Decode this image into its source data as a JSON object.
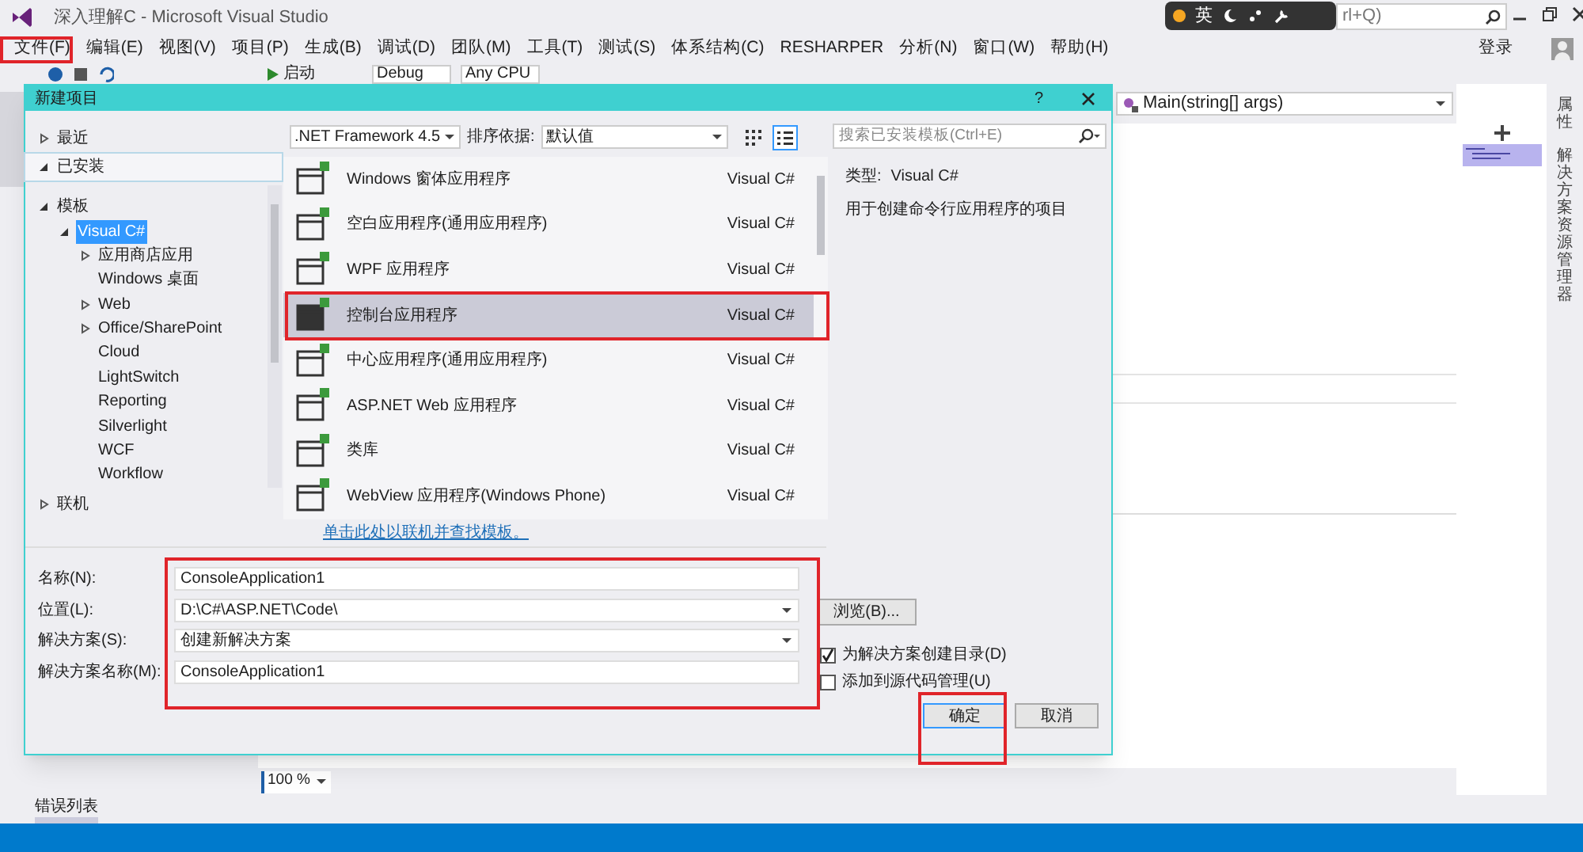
{
  "window": {
    "title": "深入理解C - Microsoft Visual Studio"
  },
  "ime_bar": {
    "label": "英"
  },
  "quick_launch": {
    "placeholder": "rl+Q)"
  },
  "menu": [
    {
      "label": "文件(F)"
    },
    {
      "label": "编辑(E)"
    },
    {
      "label": "视图(V)"
    },
    {
      "label": "项目(P)"
    },
    {
      "label": "生成(B)"
    },
    {
      "label": "调试(D)"
    },
    {
      "label": "团队(M)"
    },
    {
      "label": "工具(T)"
    },
    {
      "label": "测试(S)"
    },
    {
      "label": "体系结构(C)"
    },
    {
      "label": "RESHARPER"
    },
    {
      "label": "分析(N)"
    },
    {
      "label": "窗口(W)"
    },
    {
      "label": "帮助(H)"
    }
  ],
  "account": {
    "label": "登录"
  },
  "toolbar": {
    "start": "启动",
    "config": "Debug",
    "platform": "Any CPU"
  },
  "dialog": {
    "title": "新建项目",
    "help": "?",
    "categories": [
      {
        "label": "最近",
        "expanded": false,
        "selected": false
      },
      {
        "label": "已安装",
        "expanded": true,
        "selected": true,
        "children": [
          {
            "label": "模板",
            "kind": "group",
            "expanded": true,
            "selected": false,
            "children": [
              {
                "label": "Visual C#",
                "kind": "group",
                "expanded": true,
                "selected": true,
                "children": [
                  {
                    "label": "应用商店应用",
                    "kind": "group",
                    "expanded": false,
                    "selected": false
                  },
                  {
                    "label": "Windows 桌面",
                    "kind": "leaf",
                    "selected": false
                  },
                  {
                    "label": "Web",
                    "kind": "group",
                    "expanded": false,
                    "selected": false
                  },
                  {
                    "label": "Office/SharePoint",
                    "kind": "group",
                    "expanded": false,
                    "selected": false
                  },
                  {
                    "label": "Cloud",
                    "kind": "leaf",
                    "selected": false
                  },
                  {
                    "label": "LightSwitch",
                    "kind": "leaf",
                    "selected": false
                  },
                  {
                    "label": "Reporting",
                    "kind": "leaf",
                    "selected": false
                  },
                  {
                    "label": "Silverlight",
                    "kind": "leaf",
                    "selected": false
                  },
                  {
                    "label": "WCF",
                    "kind": "leaf",
                    "selected": false
                  },
                  {
                    "label": "Workflow",
                    "kind": "leaf",
                    "selected": false
                  }
                ]
              }
            ]
          }
        ]
      },
      {
        "label": "联机",
        "expanded": false,
        "selected": false
      }
    ],
    "framework": ".NET Framework 4.5",
    "sort_label": "排序依据:",
    "sort_value": "默认值",
    "view_modes": [
      {
        "kind": "grid",
        "selected": false
      },
      {
        "kind": "list",
        "selected": true
      }
    ],
    "templates": [
      {
        "name": "Windows 窗体应用程序",
        "language": "Visual C#",
        "selected": false
      },
      {
        "name": "空白应用程序(通用应用程序)",
        "language": "Visual C#",
        "selected": false
      },
      {
        "name": "WPF 应用程序",
        "language": "Visual C#",
        "selected": false
      },
      {
        "name": "控制台应用程序",
        "language": "Visual C#",
        "selected": true
      },
      {
        "name": "中心应用程序(通用应用程序)",
        "language": "Visual C#",
        "selected": false
      },
      {
        "name": "ASP.NET Web 应用程序",
        "language": "Visual C#",
        "selected": false
      },
      {
        "name": "类库",
        "language": "Visual C#",
        "selected": false
      },
      {
        "name": "WebView 应用程序(Windows Phone)",
        "language": "Visual C#",
        "selected": false
      }
    ],
    "online_link": "单击此处以联机并查找模板。",
    "search": {
      "placeholder": "搜索已安装模板(Ctrl+E)"
    },
    "details": {
      "type_label": "类型:",
      "type_value": "Visual C#",
      "description": "用于创建命令行应用程序的项目"
    },
    "fields": [
      {
        "label": "名称(N):",
        "value": "ConsoleApplication1",
        "kind": "text"
      },
      {
        "label": "位置(L):",
        "value": "D:\\C#\\ASP.NET\\Code\\",
        "kind": "dropdown"
      },
      {
        "label": "解决方案(S):",
        "value": "创建新解决方案",
        "kind": "dropdown"
      },
      {
        "label": "解决方案名称(M):",
        "value": "ConsoleApplication1",
        "kind": "text"
      }
    ],
    "browse_button": "浏览(B)...",
    "options": [
      {
        "label": "为解决方案创建目录(D)",
        "checked": true
      },
      {
        "label": "添加到源代码管理(U)",
        "checked": false
      }
    ],
    "buttons": [
      {
        "label": "确定"
      },
      {
        "label": "取消"
      }
    ]
  },
  "editor": {
    "member_dropdown": "Main(string[] args)",
    "zoom": "100 %"
  },
  "right_tabs": [
    {
      "label": "属性"
    },
    {
      "label": "解决方案资源管理器"
    }
  ],
  "bottom_tabs": [
    {
      "label": "错误列表"
    }
  ]
}
